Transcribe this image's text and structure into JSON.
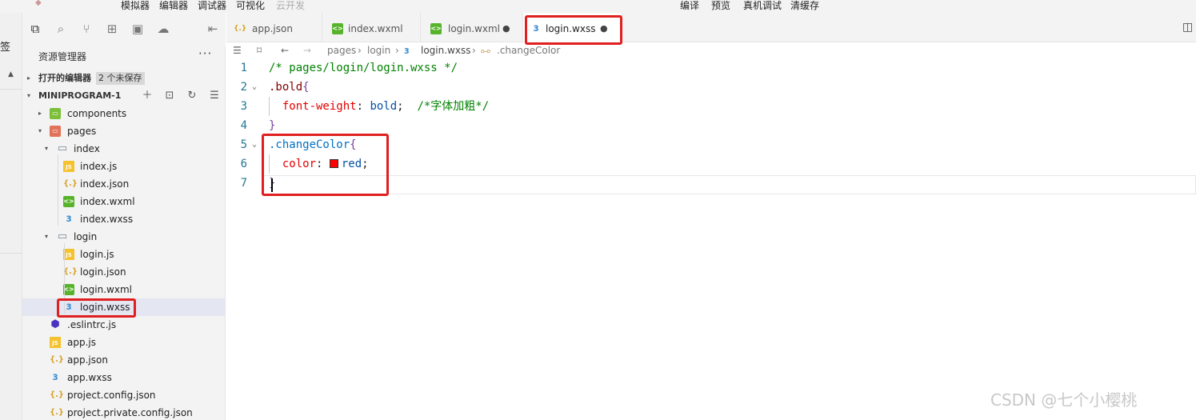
{
  "menubar": {
    "items": [
      "模拟器",
      "编辑器",
      "调试器",
      "可视化",
      "云开发"
    ],
    "right_items": [
      "编译",
      "预览",
      "真机调试",
      "清缓存"
    ]
  },
  "leftstrip": {
    "label": "签"
  },
  "activity": {
    "icons": [
      "files-icon",
      "search-icon",
      "source-control-icon",
      "extensions-icon",
      "storage-icon",
      "docker-icon",
      "collapse-panel-icon"
    ]
  },
  "explorer": {
    "title": "资源管理器",
    "more": "···",
    "open_editors": {
      "label": "打开的编辑器",
      "badge": "2 个未保存"
    },
    "project": {
      "label": "MINIPROGRAM-1"
    },
    "tree": [
      {
        "name": "components",
        "type": "folder-green",
        "depth": 1,
        "caret": "▸"
      },
      {
        "name": "pages",
        "type": "folder-red",
        "depth": 1,
        "caret": "▾"
      },
      {
        "name": "index",
        "type": "folder",
        "depth": 2,
        "caret": "▾"
      },
      {
        "name": "index.js",
        "type": "js",
        "depth": 3
      },
      {
        "name": "index.json",
        "type": "json",
        "depth": 3
      },
      {
        "name": "index.wxml",
        "type": "wxml",
        "depth": 3
      },
      {
        "name": "index.wxss",
        "type": "wxss",
        "depth": 3
      },
      {
        "name": "login",
        "type": "folder",
        "depth": 2,
        "caret": "▾"
      },
      {
        "name": "login.js",
        "type": "js",
        "depth": 3
      },
      {
        "name": "login.json",
        "type": "json",
        "depth": 3
      },
      {
        "name": "login.wxml",
        "type": "wxml",
        "depth": 3
      },
      {
        "name": "login.wxss",
        "type": "wxss",
        "depth": 3,
        "selected": true
      },
      {
        "name": ".eslintrc.js",
        "type": "eslint",
        "depth": 1
      },
      {
        "name": "app.js",
        "type": "js",
        "depth": 1
      },
      {
        "name": "app.json",
        "type": "json",
        "depth": 1
      },
      {
        "name": "app.wxss",
        "type": "wxss",
        "depth": 1
      },
      {
        "name": "project.config.json",
        "type": "json",
        "depth": 1
      },
      {
        "name": "project.private.config.json",
        "type": "json",
        "depth": 1
      }
    ]
  },
  "tabs": [
    {
      "label": "app.json",
      "type": "json",
      "dirty": false,
      "active": false
    },
    {
      "label": "index.wxml",
      "type": "wxml",
      "dirty": false,
      "active": false
    },
    {
      "label": "login.wxml",
      "type": "wxml",
      "dirty": true,
      "active": false
    },
    {
      "label": "login.wxss",
      "type": "wxss",
      "dirty": true,
      "active": true
    }
  ],
  "breadcrumb": {
    "parts": [
      "pages",
      "login",
      "login.wxss",
      ".changeColor"
    ]
  },
  "editor": {
    "lines": [
      {
        "n": "1",
        "text": "/* pages/login/login.wxss */"
      },
      {
        "n": "2",
        "text": ".bold{"
      },
      {
        "n": "3",
        "text": "  font-weight: bold;  /*字体加粗*/"
      },
      {
        "n": "4",
        "text": "}"
      },
      {
        "n": "5",
        "text": ".changeColor{"
      },
      {
        "n": "6",
        "text": "  color: red;"
      },
      {
        "n": "7",
        "text": "}"
      }
    ],
    "swatch_color": "#ff0000"
  },
  "watermark": "CSDN @七个小樱桃",
  "colors": {
    "highlight": "#e02020",
    "accent": "#3d8fd7"
  }
}
